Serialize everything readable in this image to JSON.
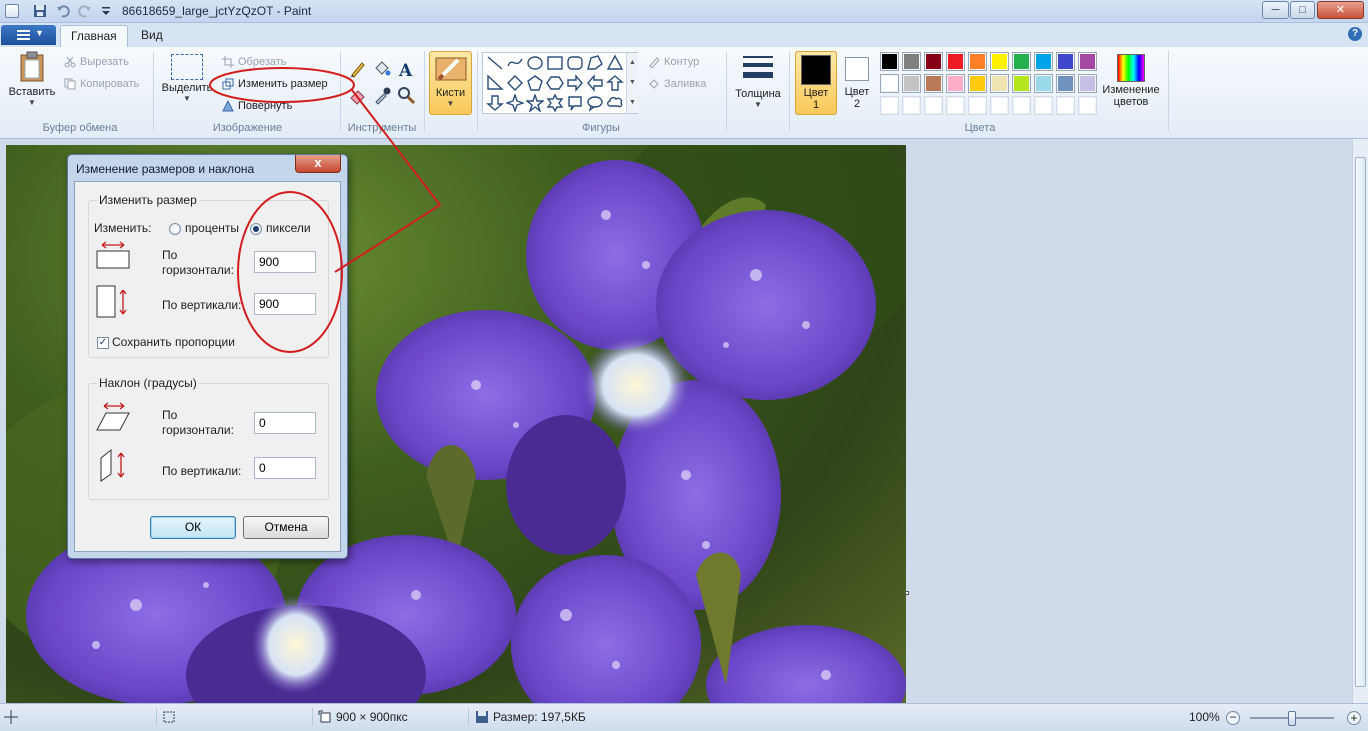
{
  "window": {
    "title": "86618659_large_jctYzQzOT - Paint",
    "minimize": "─",
    "maximize": "□",
    "close": "✕"
  },
  "tabs": [
    {
      "label": "Главная",
      "active": true
    },
    {
      "label": "Вид",
      "active": false
    }
  ],
  "help": "?",
  "ribbon": {
    "clipboard": {
      "label": "Буфер обмена",
      "paste": "Вставить",
      "cut": "Вырезать",
      "copy": "Копировать"
    },
    "image": {
      "label": "Изображение",
      "select": "Выделить",
      "crop": "Обрезать",
      "resize": "Изменить размер",
      "rotate": "Повернуть"
    },
    "tools": {
      "label": "Инструменты"
    },
    "brushes": {
      "label": "Кисти"
    },
    "shapes": {
      "label": "Фигуры",
      "outline": "Контур",
      "fill": "Заливка"
    },
    "size": {
      "label": "Толщина"
    },
    "colors": {
      "label": "Цвета",
      "color1": "Цвет",
      "color1_num": "1",
      "color2": "Цвет",
      "color2_num": "2",
      "edit_colors": "Изменение",
      "edit_colors_2": "цветов",
      "palette_row1": [
        "#000000",
        "#7f7f7f",
        "#880015",
        "#ed1c24",
        "#ff7f27",
        "#fff200",
        "#22b14c",
        "#00a2e8",
        "#3f48cc",
        "#a349a4"
      ],
      "palette_row2": [
        "#ffffff",
        "#c3c3c3",
        "#b97a57",
        "#ffaec9",
        "#ffc90e",
        "#efe4b0",
        "#b5e61d",
        "#99d9ea",
        "#7092be",
        "#c8bfe7"
      ],
      "palette_row3": [
        "#ffffff",
        "#ffffff",
        "#ffffff",
        "#ffffff",
        "#ffffff",
        "#ffffff",
        "#ffffff",
        "#ffffff",
        "#ffffff",
        "#ffffff"
      ]
    }
  },
  "dialog": {
    "title": "Изменение размеров и наклона",
    "close": "x",
    "resize": {
      "legend": "Изменить размер",
      "by_label": "Изменить:",
      "percent": "проценты",
      "pixels": "пиксели",
      "horizontal_1": "По",
      "horizontal_2": "горизонтали:",
      "horizontal_value": "900",
      "vertical": "По вертикали:",
      "vertical_value": "900",
      "keep_ratio": "Сохранить пропорции"
    },
    "skew": {
      "legend": "Наклон (градусы)",
      "horizontal_1": "По",
      "horizontal_2": "горизонтали:",
      "horizontal_value": "0",
      "vertical": "По вертикали:",
      "vertical_value": "0"
    },
    "ok": "ОК",
    "cancel": "Отмена"
  },
  "status": {
    "dimensions": "900 × 900пкс",
    "size": "Размер: 197,5КБ",
    "zoom": "100%",
    "zoom_value_pct": 100
  }
}
